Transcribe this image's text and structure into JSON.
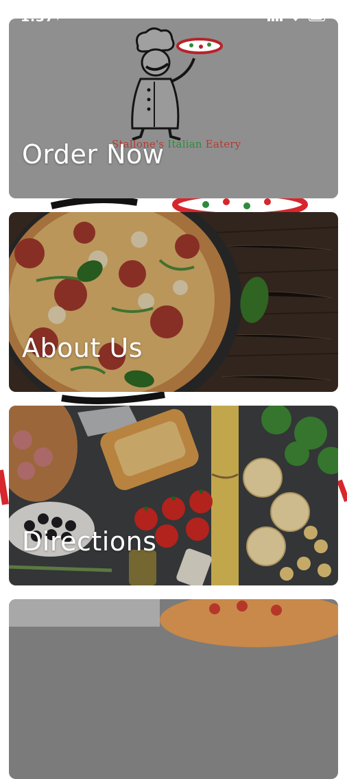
{
  "status_bar": {
    "time": "1:37",
    "icons": [
      "location-arrow-icon",
      "signal-icon",
      "wifi-icon",
      "battery-icon"
    ]
  },
  "brand": {
    "name_part1": "Stallone's",
    "name_part2": "Italian",
    "name_part3": "Eatery"
  },
  "menu": {
    "items": [
      {
        "label": "Order Now"
      },
      {
        "label": "About Us"
      },
      {
        "label": "Directions"
      }
    ]
  },
  "colors": {
    "order_card_bg": "#8f8f8f",
    "brand_red": "#d7262c",
    "brand_green": "#2e8b3a"
  }
}
